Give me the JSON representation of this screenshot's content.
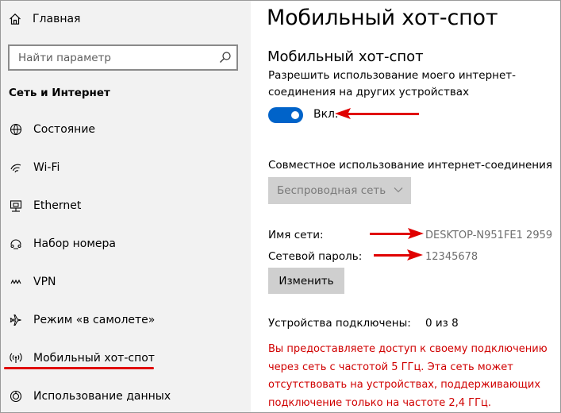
{
  "sidebar": {
    "home_label": "Главная",
    "search_placeholder": "Найти параметр",
    "section_title": "Сеть и Интернет",
    "items": [
      {
        "label": "Состояние",
        "icon": "status-icon"
      },
      {
        "label": "Wi-Fi",
        "icon": "wifi-icon"
      },
      {
        "label": "Ethernet",
        "icon": "ethernet-icon"
      },
      {
        "label": "Набор номера",
        "icon": "dialup-icon"
      },
      {
        "label": "VPN",
        "icon": "vpn-icon"
      },
      {
        "label": "Режим «в самолете»",
        "icon": "airplane-icon"
      },
      {
        "label": "Мобильный хот-спот",
        "icon": "hotspot-icon",
        "selected": true
      },
      {
        "label": "Использование данных",
        "icon": "data-usage-icon"
      }
    ]
  },
  "main": {
    "page_title": "Мобильный хот-спот",
    "subtitle": "Мобильный хот-спот",
    "description": "Разрешить использование моего интернет-соединения на других устройствах",
    "toggle_state": "Вкл.",
    "share_label": "Совместное использование интернет-соединения",
    "share_selected": "Беспроводная сеть",
    "network_name_label": "Имя сети:",
    "network_name_value": "DESKTOP-N951FE1 2959",
    "password_label": "Сетевой пароль:",
    "password_value": "12345678",
    "edit_button": "Изменить",
    "devices_label": "Устройства подключены:",
    "devices_value": "0 из 8",
    "warning": "Вы предоставляете доступ к своему подключению через сеть с частотой 5 ГГц. Эта сеть может отсутствовать на устройствах, поддерживающих подключение только на частоте 2,4 ГГц."
  },
  "colors": {
    "accent": "#0063c9",
    "annotation": "#e00000",
    "warning_text": "#d00000",
    "sidebar_bg": "#f2f2f2"
  }
}
